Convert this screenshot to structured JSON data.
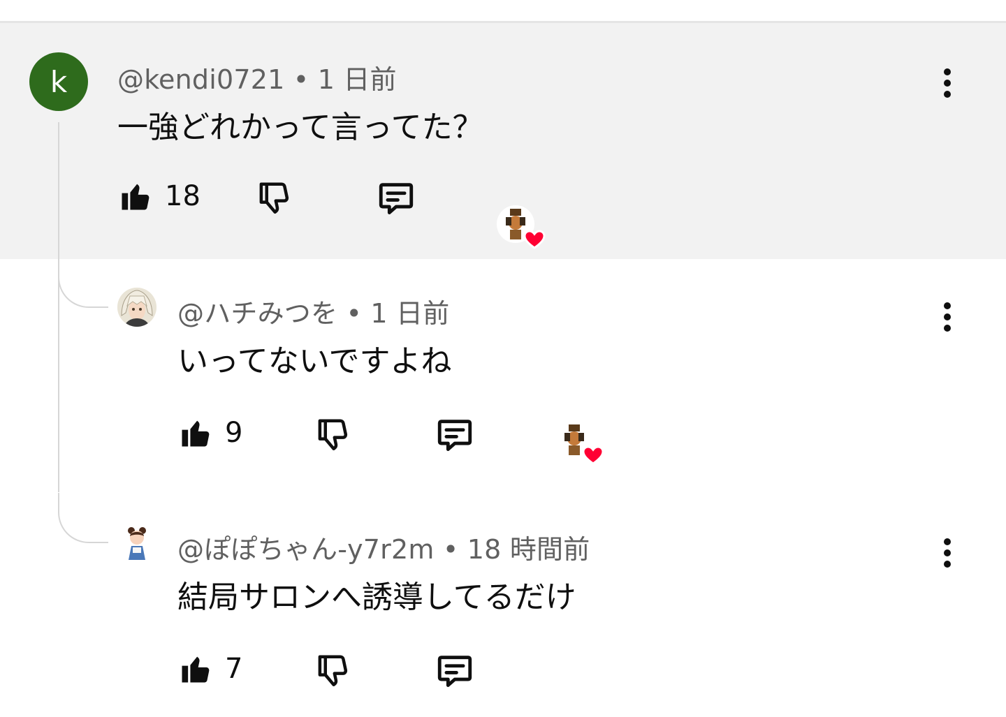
{
  "comments": [
    {
      "avatar_letter": "k",
      "author": "@kendi0721",
      "separator": "•",
      "time": "1 日前",
      "text": "一強どれかって言ってた？",
      "likes": "18",
      "creator_heart": true
    },
    {
      "author": "@ハチみつを",
      "separator": "•",
      "time": "1 日前",
      "text": "いってないですよね",
      "likes": "9",
      "creator_heart": true
    },
    {
      "author": "@ぽぽちゃん-y7r2m",
      "separator": "•",
      "time": "18 時間前",
      "text": "結局サロンへ誘導してるだけ",
      "likes": "7",
      "creator_heart": false
    }
  ],
  "icons": {
    "like": "thumb-up-icon",
    "dislike": "thumb-down-icon",
    "reply": "comment-reply-icon",
    "more": "more-vert-icon",
    "heart": "creator-heart-icon"
  },
  "colors": {
    "highlight_bg": "#f2f2f2",
    "avatar_k_bg": "#2e6b1c",
    "heart": "#ff0033",
    "meta_text": "#606060"
  }
}
